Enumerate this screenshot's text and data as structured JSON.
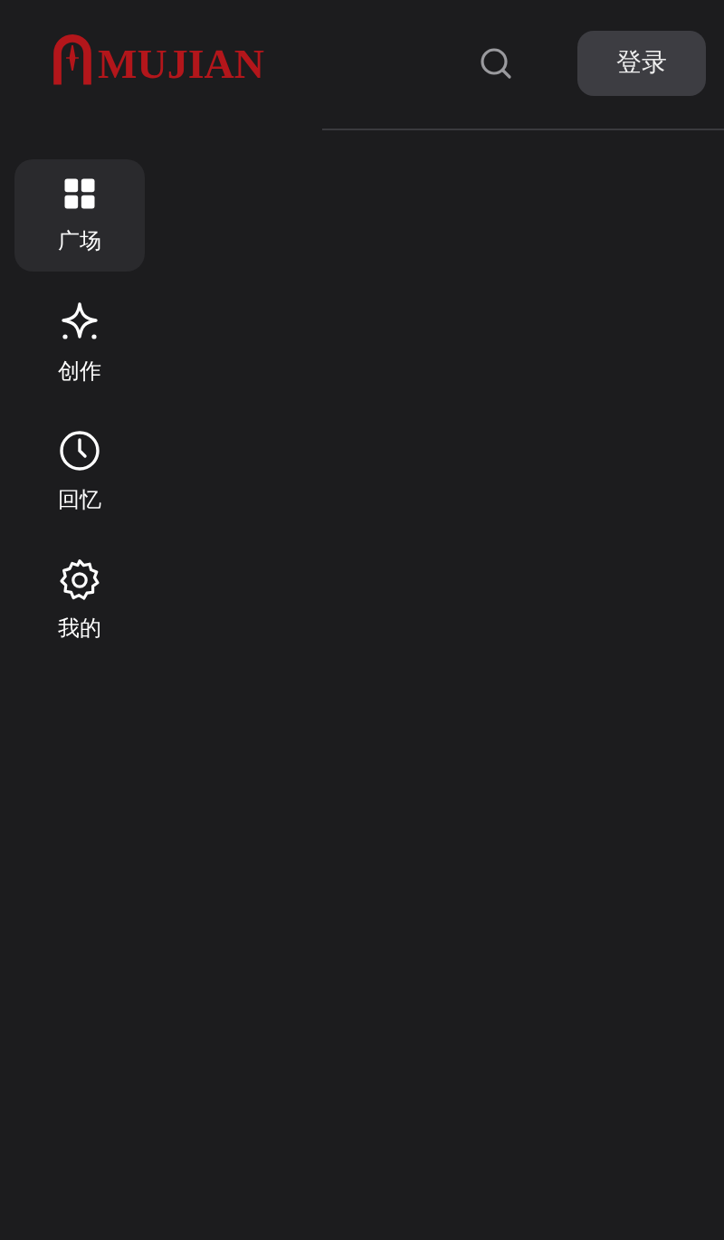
{
  "header": {
    "logo_text": "MUJIAN",
    "login_button": "登录"
  },
  "sidebar": {
    "items": [
      {
        "label": "广场",
        "selected": true
      },
      {
        "label": "创作",
        "selected": false
      },
      {
        "label": "回忆",
        "selected": false
      },
      {
        "label": "我的",
        "selected": false
      }
    ]
  }
}
